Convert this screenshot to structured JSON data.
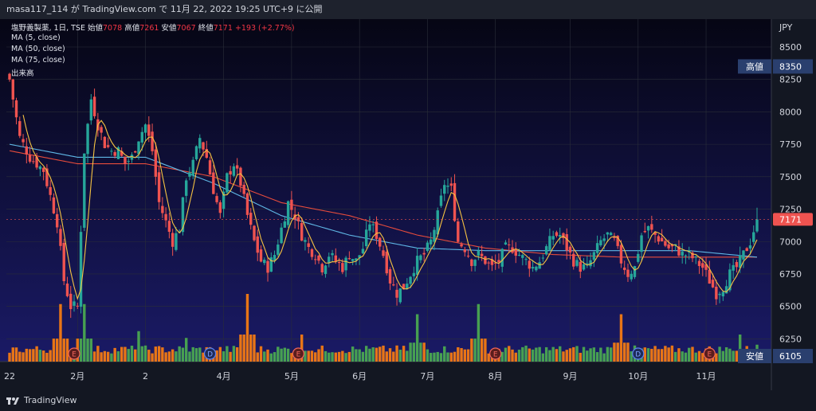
{
  "header": {
    "caption": "masa117_114 が TradingView.com で 11月 22, 2022 19:25 UTC+9 に公開"
  },
  "legend": {
    "symbol": "塩野義製薬, 1日, TSE",
    "open_label": "始値",
    "open_value": "7078",
    "high_label": "高値",
    "high_value": "7261",
    "low_label": "安値",
    "low_value": "7067",
    "close_label": "終値",
    "close_value": "7171",
    "change": "+193 (+2.77%)",
    "ma5": "MA (5, close)",
    "ma50": "MA (50, close)",
    "ma75": "MA (75, close)",
    "volume": "出来高"
  },
  "price_axis": {
    "currency": "JPY",
    "ticks": [
      "8500",
      "8250",
      "8000",
      "7750",
      "7500",
      "7250",
      "7000",
      "6750",
      "6500",
      "6250"
    ],
    "tick_values": [
      8500,
      8250,
      8000,
      7750,
      7500,
      7250,
      7000,
      6750,
      6500,
      6250
    ],
    "last_price_label": "7171",
    "high_marker_label": "高値",
    "high_marker_value": "8350",
    "low_marker_label": "安値",
    "low_marker_value": "6105"
  },
  "time_axis": {
    "labels": [
      "22",
      "2月",
      "2",
      "4月",
      "5月",
      "6月",
      "7月",
      "8月",
      "9月",
      "10月",
      "11月"
    ],
    "label_days": [
      0,
      20,
      40,
      63,
      83,
      103,
      123,
      143,
      165,
      185,
      205
    ]
  },
  "event_markers": [
    {
      "type": "E",
      "day": 19
    },
    {
      "type": "D",
      "day": 59
    },
    {
      "type": "E",
      "day": 85
    },
    {
      "type": "E",
      "day": 143
    },
    {
      "type": "D",
      "day": 185
    },
    {
      "type": "E",
      "day": 206
    }
  ],
  "footer": {
    "brand": "TradingView"
  },
  "colors": {
    "up": "#26a69a",
    "down": "#ef5350",
    "ma5": "#f5c242",
    "ma50": "#5fb7e5",
    "ma75": "#e74c3c",
    "vol_up": "#4caf50",
    "vol_down": "#ff7f0e",
    "last_price_bg": "#ef5350",
    "marker_bg": "#2a3f6e"
  },
  "chart_data": {
    "type": "candlestick",
    "x_unit": "trading day index (approx.)",
    "y_range": [
      6105,
      8500
    ],
    "anchors_close": [
      [
        0,
        8250
      ],
      [
        3,
        7800
      ],
      [
        6,
        7650
      ],
      [
        10,
        7550
      ],
      [
        14,
        7150
      ],
      [
        16,
        6700
      ],
      [
        18,
        6500
      ],
      [
        20,
        6500
      ],
      [
        22,
        7700
      ],
      [
        24,
        8100
      ],
      [
        26,
        7900
      ],
      [
        28,
        7750
      ],
      [
        30,
        7700
      ],
      [
        32,
        7700
      ],
      [
        34,
        7600
      ],
      [
        36,
        7650
      ],
      [
        38,
        7800
      ],
      [
        40,
        7900
      ],
      [
        42,
        7700
      ],
      [
        44,
        7300
      ],
      [
        46,
        7150
      ],
      [
        48,
        7000
      ],
      [
        50,
        7100
      ],
      [
        52,
        7500
      ],
      [
        54,
        7600
      ],
      [
        56,
        7800
      ],
      [
        58,
        7650
      ],
      [
        60,
        7400
      ],
      [
        62,
        7200
      ],
      [
        64,
        7500
      ],
      [
        66,
        7600
      ],
      [
        68,
        7450
      ],
      [
        70,
        7200
      ],
      [
        72,
        7000
      ],
      [
        74,
        6850
      ],
      [
        76,
        6800
      ],
      [
        78,
        6900
      ],
      [
        80,
        7100
      ],
      [
        82,
        7300
      ],
      [
        84,
        7200
      ],
      [
        86,
        7050
      ],
      [
        88,
        6950
      ],
      [
        90,
        6900
      ],
      [
        92,
        6800
      ],
      [
        94,
        6900
      ],
      [
        96,
        6850
      ],
      [
        98,
        6800
      ],
      [
        100,
        6900
      ],
      [
        102,
        6850
      ],
      [
        104,
        6950
      ],
      [
        106,
        7150
      ],
      [
        108,
        7050
      ],
      [
        110,
        6900
      ],
      [
        112,
        6700
      ],
      [
        114,
        6600
      ],
      [
        116,
        6650
      ],
      [
        118,
        6750
      ],
      [
        120,
        6850
      ],
      [
        122,
        6900
      ],
      [
        124,
        7000
      ],
      [
        126,
        7200
      ],
      [
        128,
        7450
      ],
      [
        130,
        7400
      ],
      [
        132,
        7000
      ],
      [
        134,
        6950
      ],
      [
        136,
        6850
      ],
      [
        138,
        6900
      ],
      [
        140,
        6850
      ],
      [
        142,
        6800
      ],
      [
        144,
        6850
      ],
      [
        146,
        6950
      ],
      [
        148,
        6950
      ],
      [
        150,
        6900
      ],
      [
        152,
        6850
      ],
      [
        154,
        6800
      ],
      [
        156,
        6850
      ],
      [
        158,
        6950
      ],
      [
        160,
        7050
      ],
      [
        162,
        7050
      ],
      [
        164,
        6950
      ],
      [
        166,
        6850
      ],
      [
        168,
        6800
      ],
      [
        170,
        6800
      ],
      [
        172,
        6900
      ],
      [
        174,
        7000
      ],
      [
        176,
        7050
      ],
      [
        178,
        7000
      ],
      [
        180,
        6850
      ],
      [
        182,
        6750
      ],
      [
        184,
        6800
      ],
      [
        186,
        7050
      ],
      [
        188,
        7100
      ],
      [
        190,
        7050
      ],
      [
        192,
        7000
      ],
      [
        194,
        6950
      ],
      [
        196,
        6950
      ],
      [
        198,
        6900
      ],
      [
        200,
        6900
      ],
      [
        202,
        6850
      ],
      [
        204,
        6800
      ],
      [
        206,
        6700
      ],
      [
        208,
        6600
      ],
      [
        210,
        6650
      ],
      [
        212,
        6750
      ],
      [
        214,
        6800
      ],
      [
        216,
        6900
      ],
      [
        218,
        7000
      ],
      [
        220,
        7171
      ]
    ],
    "ma50_anchors": [
      [
        0,
        7750
      ],
      [
        20,
        7650
      ],
      [
        40,
        7650
      ],
      [
        60,
        7450
      ],
      [
        80,
        7200
      ],
      [
        100,
        7050
      ],
      [
        120,
        6950
      ],
      [
        140,
        6930
      ],
      [
        160,
        6930
      ],
      [
        180,
        6930
      ],
      [
        200,
        6930
      ],
      [
        220,
        6880
      ]
    ],
    "ma75_anchors": [
      [
        0,
        7700
      ],
      [
        20,
        7600
      ],
      [
        40,
        7600
      ],
      [
        60,
        7500
      ],
      [
        80,
        7300
      ],
      [
        100,
        7200
      ],
      [
        120,
        7050
      ],
      [
        140,
        6950
      ],
      [
        160,
        6900
      ],
      [
        180,
        6880
      ],
      [
        200,
        6880
      ],
      [
        220,
        6880
      ]
    ],
    "volume_spikes": [
      [
        15,
        0.85
      ],
      [
        22,
        0.85
      ],
      [
        38,
        0.45
      ],
      [
        52,
        0.35
      ],
      [
        70,
        1.0
      ],
      [
        86,
        0.4
      ],
      [
        120,
        0.7
      ],
      [
        138,
        0.85
      ],
      [
        180,
        0.7
      ],
      [
        215,
        0.4
      ],
      [
        220,
        0.25
      ]
    ]
  }
}
